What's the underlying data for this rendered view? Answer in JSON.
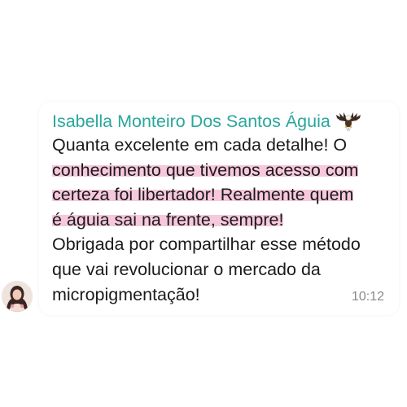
{
  "message": {
    "sender_name": "Isabella Monteiro Dos Santos Águia",
    "sender_icon": "eagle-icon",
    "lines": [
      "Quanta excelente em cada detalhe! O",
      "conhecimento que tivemos acesso com",
      "certeza foi libertador! Realmente quem",
      "é águia sai na frente, sempre!",
      "Obrigada por compartilhar esse método",
      "que vai revolucionar o mercado da",
      "micropigmentação!"
    ],
    "highlighted_line_indices": [
      1,
      2,
      3
    ],
    "highlight_color": "#f7c8dc",
    "time": "10:12"
  },
  "colors": {
    "sender_name": "#2aa79b",
    "text": "#1b1b1b",
    "timestamp": "#8a8a8a",
    "background": "#ffffff"
  }
}
